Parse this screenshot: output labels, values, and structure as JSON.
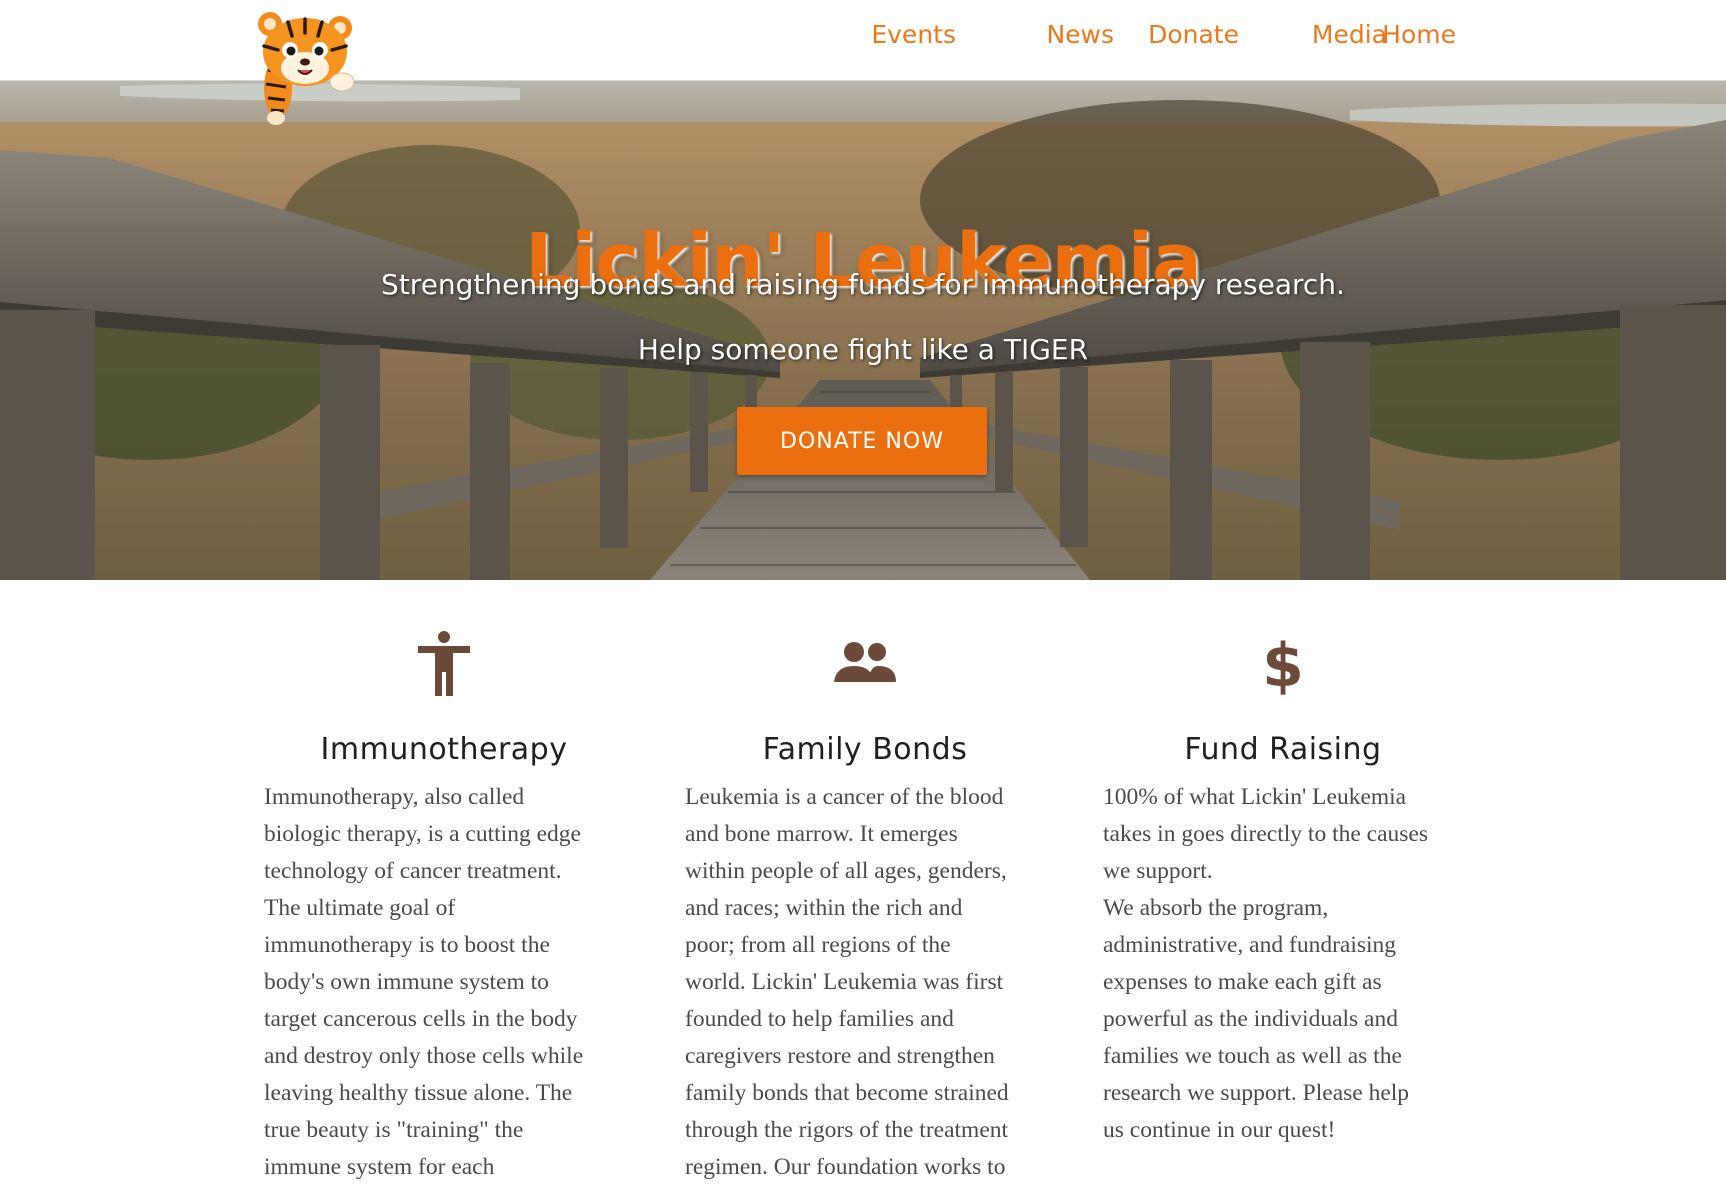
{
  "header": {
    "logo_name": "tiger-cub-logo",
    "nav": [
      {
        "label": "Events"
      },
      {
        "label": "News"
      },
      {
        "label": "Donate"
      },
      {
        "label": "Media"
      },
      {
        "label": "Home"
      }
    ]
  },
  "hero": {
    "title": "Lickin' Leukemia",
    "subtitle": "Strengthening bonds and raising funds for immunotherapy research.",
    "tagline": "Help someone fight like a TIGER",
    "button_label": "DONATE NOW"
  },
  "features": [
    {
      "icon": "person-accessibility-icon",
      "title": "Immunotherapy",
      "text": "Immunotherapy, also called\nbiologic therapy, is a cutting edge\ntechnology of cancer treatment.\nThe ultimate goal of\nimmunotherapy is to boost the\nbody's own immune system to\ntarget cancerous cells in the body\nand destroy only those cells while\nleaving healthy tissue alone. The\ntrue beauty is \"training\" the\nimmune system for each"
    },
    {
      "icon": "people-group-icon",
      "title": "Family Bonds",
      "text": "Leukemia is a cancer of the blood\nand bone marrow. It emerges\nwithin people of all ages, genders,\nand races; within the rich and\npoor; from all regions of the\nworld. Lickin' Leukemia was first\nfounded to help families and\ncaregivers restore and strengthen\nfamily bonds that become strained\nthrough the rigors of the treatment\nregimen. Our foundation works to"
    },
    {
      "icon": "dollar-sign-icon",
      "title": "Fund Raising",
      "text": "100% of what Lickin' Leukemia\ntakes in goes directly to the causes\nwe support.\nWe absorb the program,\nadministrative, and fundraising\nexpenses to make each gift as\npowerful as the individuals and\nfamilies we touch as well as the\nresearch we support. Please help\nus continue in our quest!"
    }
  ],
  "colors": {
    "accent": "#ec6f0f",
    "nav_text": "#e8791c",
    "icon": "#6b4a3a"
  }
}
